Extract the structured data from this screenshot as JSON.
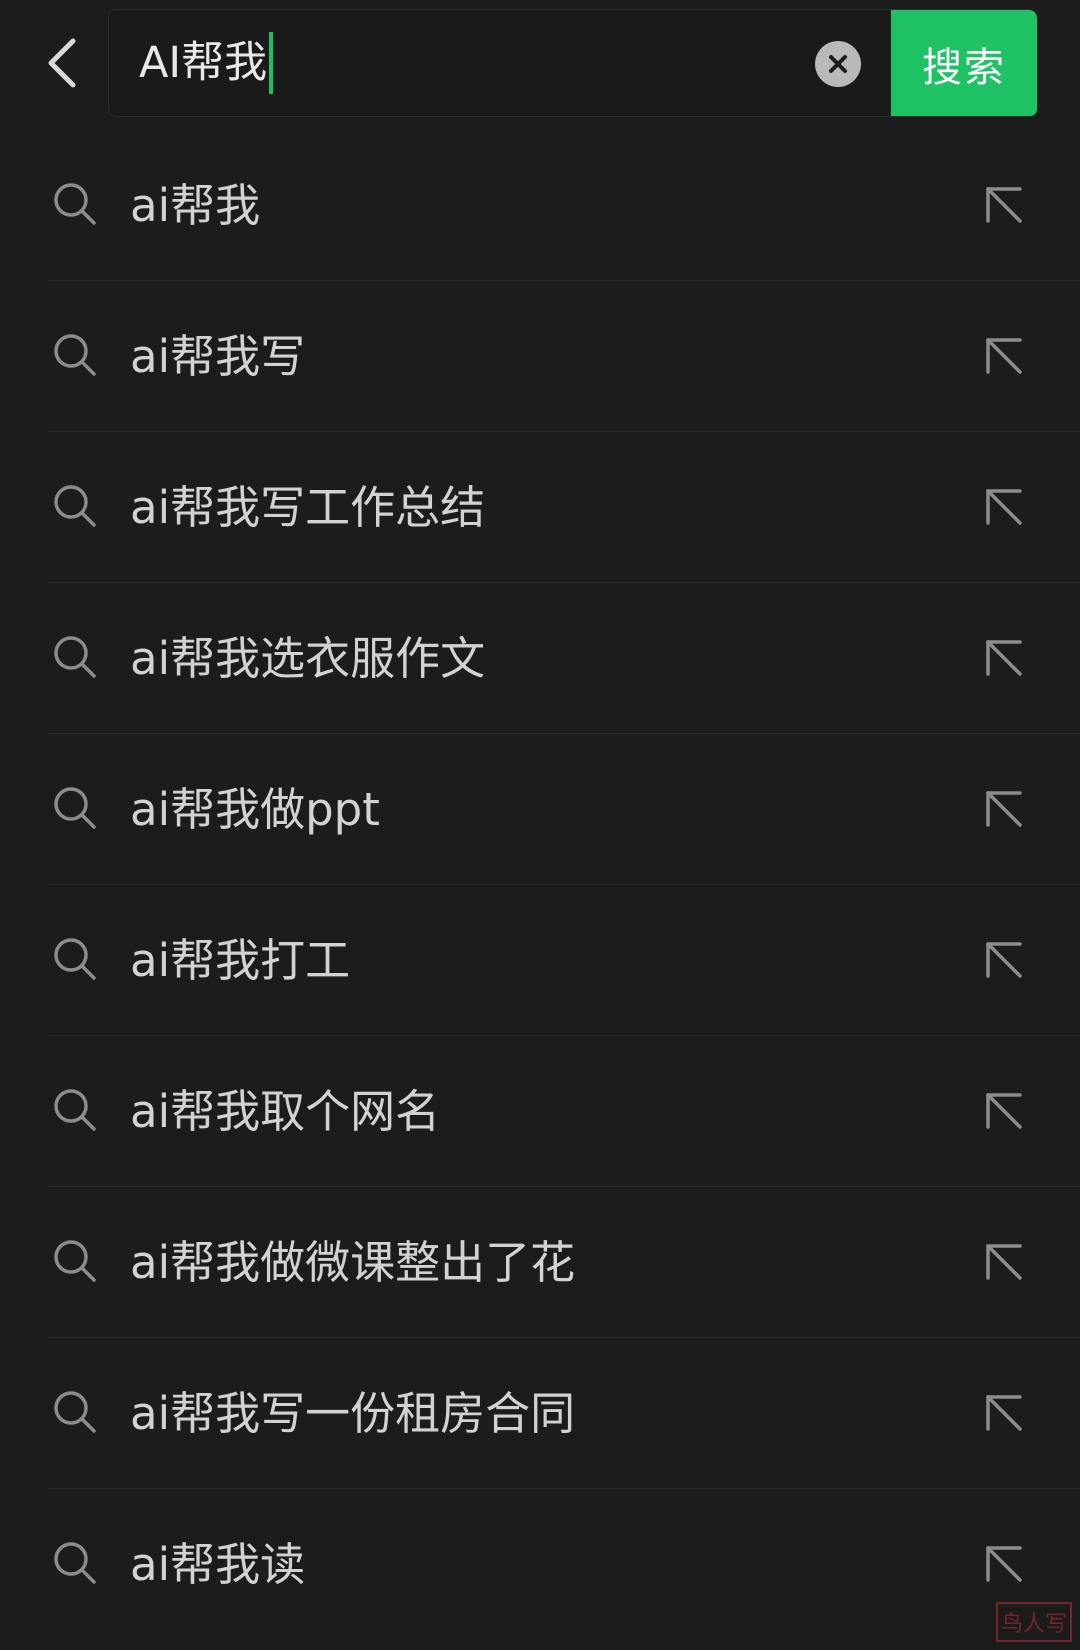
{
  "search": {
    "query": "AI帮我",
    "button_label": "搜索"
  },
  "icons": {
    "back": "chevron-left-icon",
    "clear": "clear-circle-icon",
    "suggestion": "search-icon",
    "fill": "arrow-up-left-icon"
  },
  "colors": {
    "background": "#1c1c1c",
    "accent": "#1ec264",
    "text": "#d2d2d2"
  },
  "suggestions": [
    "ai帮我",
    "ai帮我写",
    "ai帮我写工作总结",
    "ai帮我选衣服作文",
    "ai帮我做ppt",
    "ai帮我打工",
    "ai帮我取个网名",
    "ai帮我做微课整出了花",
    "ai帮我写一份租房合同",
    "ai帮我读"
  ],
  "watermark": "鸟人写"
}
